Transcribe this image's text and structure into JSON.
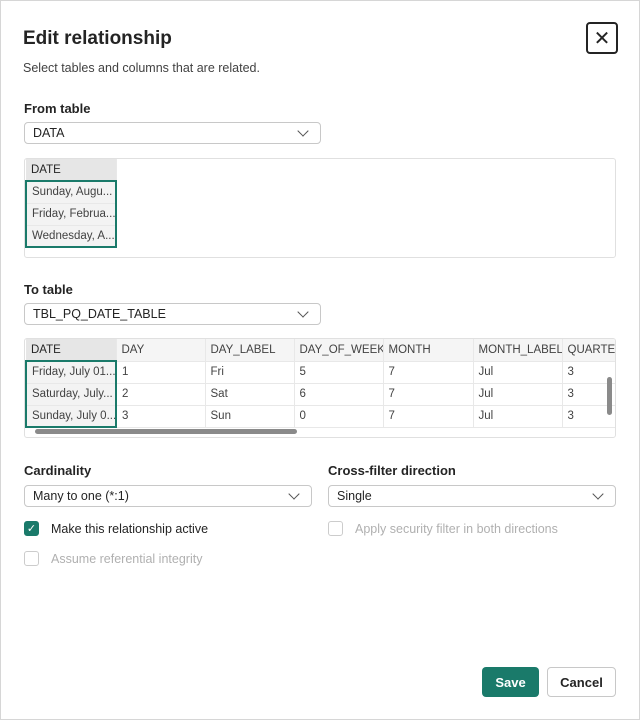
{
  "dialog": {
    "title": "Edit relationship",
    "subtitle": "Select tables and columns that are related."
  },
  "from": {
    "label": "From table",
    "value": "DATA",
    "columns": [
      "DATE"
    ],
    "rows": [
      [
        "Sunday, Augu..."
      ],
      [
        "Friday, Februa..."
      ],
      [
        "Wednesday, A..."
      ]
    ]
  },
  "to": {
    "label": "To table",
    "value": "TBL_PQ_DATE_TABLE",
    "columns": [
      "DATE",
      "DAY",
      "DAY_LABEL",
      "DAY_OF_WEEK",
      "MONTH",
      "MONTH_LABEL",
      "QUARTER"
    ],
    "rows": [
      [
        "Friday, July 01...",
        "1",
        "Fri",
        "5",
        "7",
        "Jul",
        "3"
      ],
      [
        "Saturday, July...",
        "2",
        "Sat",
        "6",
        "7",
        "Jul",
        "3"
      ],
      [
        "Sunday, July 0...",
        "3",
        "Sun",
        "0",
        "7",
        "Jul",
        "3"
      ]
    ]
  },
  "cardinality": {
    "label": "Cardinality",
    "value": "Many to one (*:1)"
  },
  "crossfilter": {
    "label": "Cross-filter direction",
    "value": "Single"
  },
  "options": {
    "active": "Make this relationship active",
    "security": "Apply security filter in both directions",
    "integrity": "Assume referential integrity"
  },
  "buttons": {
    "save": "Save",
    "cancel": "Cancel"
  },
  "colors": {
    "accent": "#1a7a6a"
  }
}
